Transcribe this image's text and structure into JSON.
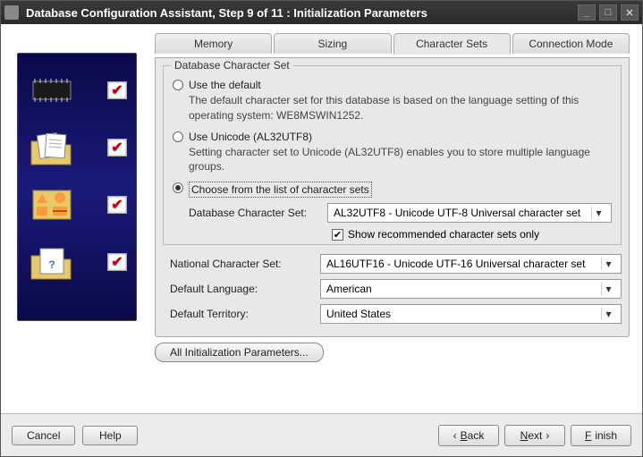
{
  "window": {
    "title": "Database Configuration Assistant, Step 9 of 11 : Initialization Parameters"
  },
  "tabs": {
    "memory": "Memory",
    "sizing": "Sizing",
    "charsets": "Character Sets",
    "connection": "Connection Mode"
  },
  "fieldset": {
    "legend": "Database Character Set",
    "opt_default_label": "Use the default",
    "opt_default_desc": "The default character set for this database is based on the language setting of this operating system: WE8MSWIN1252.",
    "opt_unicode_label": "Use Unicode (AL32UTF8)",
    "opt_unicode_desc": "Setting character set to Unicode (AL32UTF8) enables you to store multiple language groups.",
    "opt_choose_label": "Choose from the list of character sets",
    "dbcharset_label": "Database Character Set:",
    "dbcharset_value": "AL32UTF8 - Unicode UTF-8 Universal character set",
    "show_recommended": "Show recommended character sets only"
  },
  "fields": {
    "national_label": "National Character Set:",
    "national_value": "AL16UTF16 - Unicode UTF-16 Universal character set",
    "lang_label": "Default Language:",
    "lang_value": "American",
    "territory_label": "Default Territory:",
    "territory_value": "United States"
  },
  "buttons": {
    "all_params": "All Initialization Parameters...",
    "cancel": "Cancel",
    "help": "Help",
    "back": "Back",
    "next": "Next",
    "finish": "Finish"
  }
}
